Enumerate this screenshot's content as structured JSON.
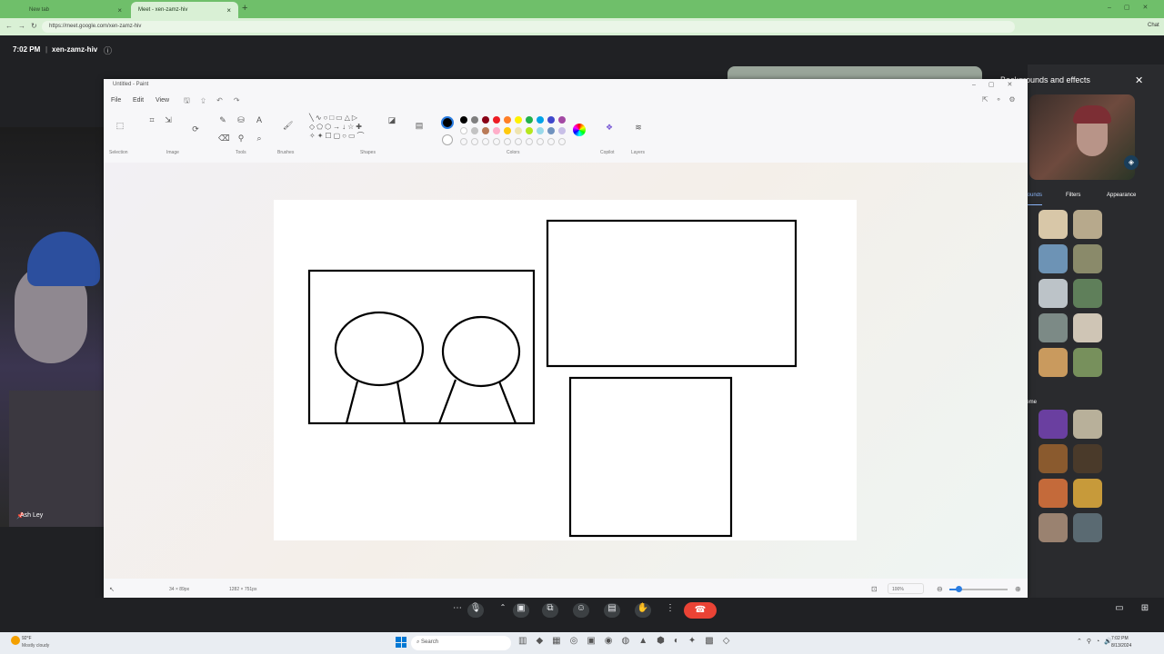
{
  "browser": {
    "tabs": [
      {
        "label": "New tab",
        "active": false
      },
      {
        "label": "Meet - xen-zamz-hiv",
        "active": true
      }
    ],
    "url": "https://meet.google.com/xen-zamz-hiv",
    "chat_label": "Chat"
  },
  "meet": {
    "time": "7:02 PM",
    "code": "xen-zamz-hiv",
    "participant_name": "Ash Ley",
    "panel_title": "Backgrounds and effects",
    "panel_tabs": [
      "Backgrounds",
      "Filters",
      "Appearance"
    ],
    "panel_section2": "Theme"
  },
  "paint": {
    "title": "Untitled - Paint",
    "menus": [
      "File",
      "Edit",
      "View"
    ],
    "groups": [
      "Selection",
      "Image",
      "Tools",
      "Brushes",
      "Shapes",
      "Colors",
      "Copilot",
      "Layers"
    ],
    "status_selection": "34 × 89px",
    "status_size": "1282 × 751px",
    "zoom": "100%",
    "colors": [
      "#000000",
      "#7f7f7f",
      "#880015",
      "#ed1c24",
      "#ff7f27",
      "#fff200",
      "#22b14c",
      "#00a2e8",
      "#3f48cc",
      "#a349a4"
    ]
  },
  "taskbar": {
    "weather_temp": "92°F",
    "weather_desc": "Mostly cloudy",
    "search": "Search",
    "time": "7:02 PM",
    "date": "8/13/2024"
  }
}
